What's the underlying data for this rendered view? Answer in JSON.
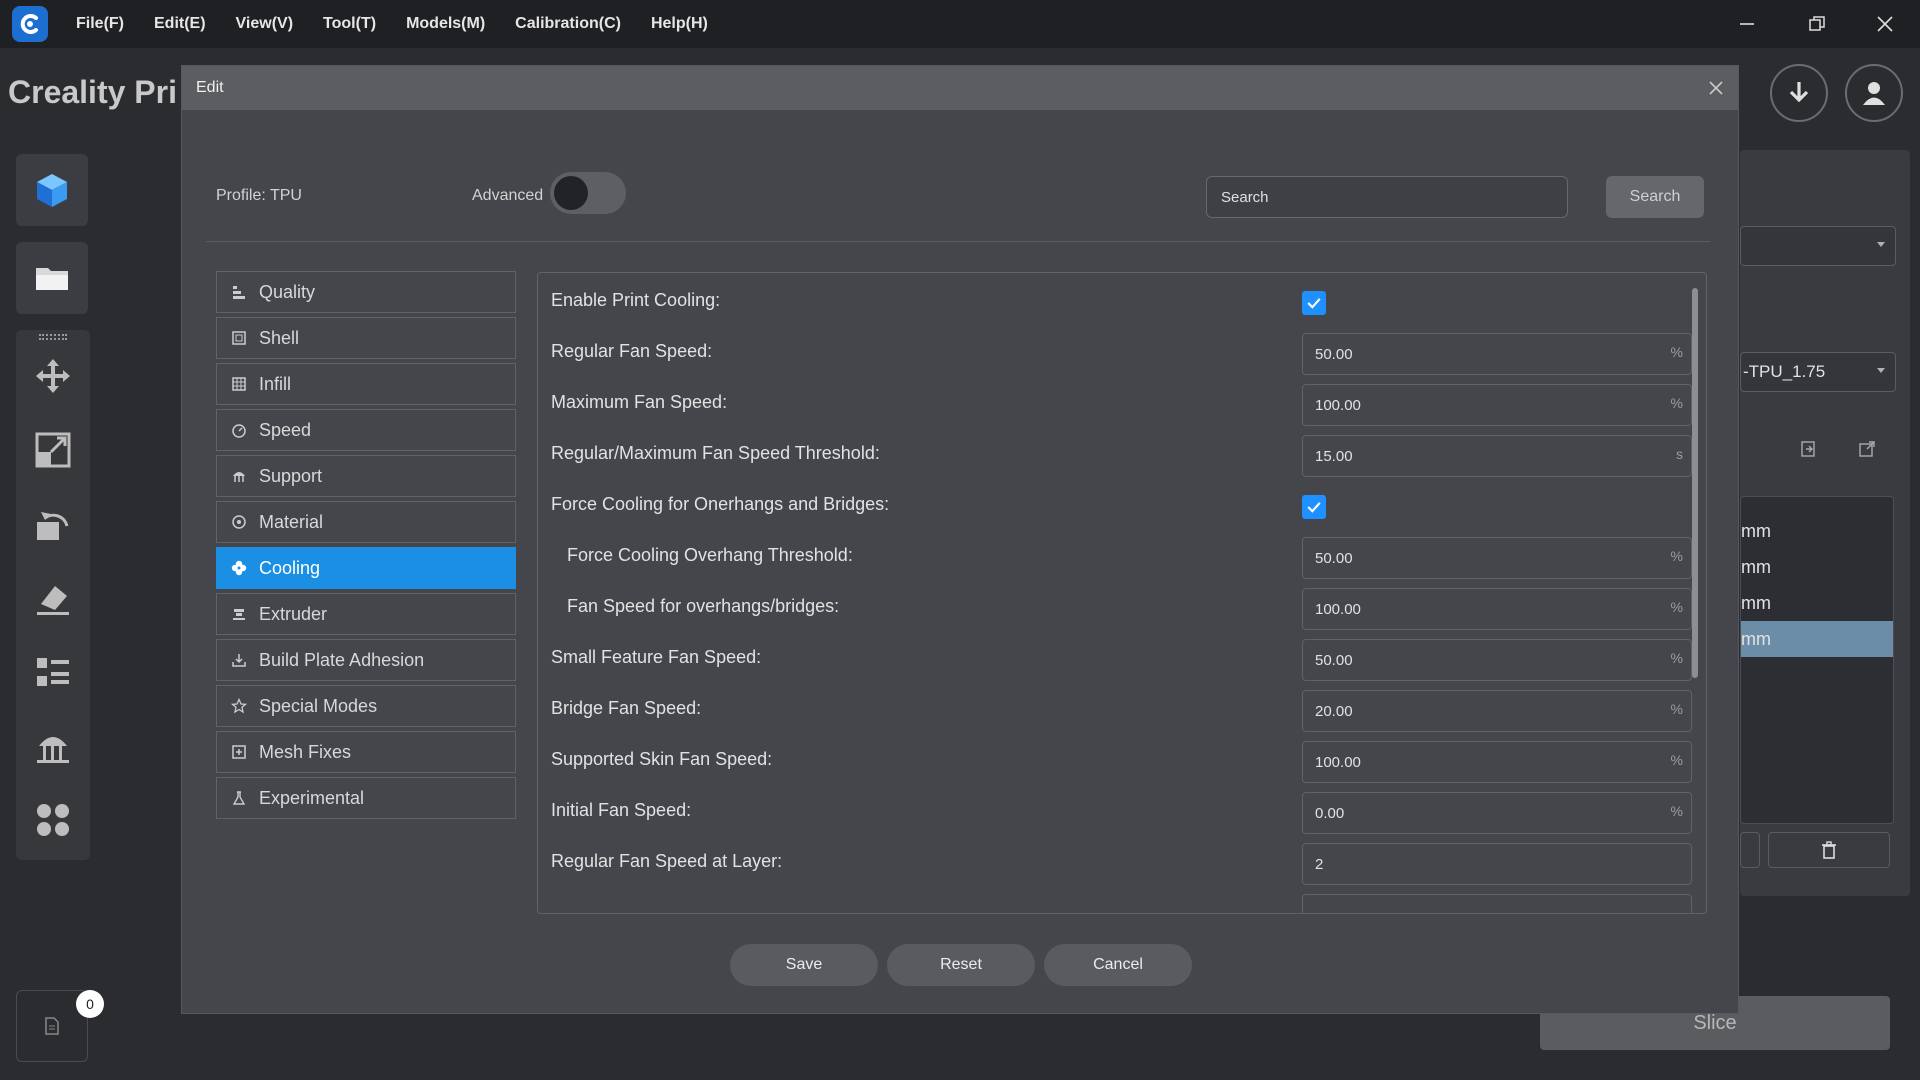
{
  "menubar": {
    "items": [
      "File(F)",
      "Edit(E)",
      "View(V)",
      "Tool(T)",
      "Models(M)",
      "Calibration(C)",
      "Help(H)"
    ]
  },
  "app": {
    "title_partial": "Creality Pri"
  },
  "right_panel": {
    "material_select": "-TPU_1.75",
    "list_items": [
      "mm",
      "mm",
      "mm",
      "mm"
    ],
    "slice_label": "Slice",
    "job_count": "0"
  },
  "dialog": {
    "title": "Edit",
    "profile_label": "Profile:  TPU",
    "advanced_label": "Advanced",
    "search_placeholder": "Search",
    "search_button": "Search",
    "categories": [
      {
        "label": "Quality",
        "icon": "quality-icon"
      },
      {
        "label": "Shell",
        "icon": "shell-icon"
      },
      {
        "label": "Infill",
        "icon": "infill-icon"
      },
      {
        "label": "Speed",
        "icon": "speed-icon"
      },
      {
        "label": "Support",
        "icon": "support-icon"
      },
      {
        "label": "Material",
        "icon": "material-icon"
      },
      {
        "label": "Cooling",
        "icon": "fan-icon"
      },
      {
        "label": "Extruder",
        "icon": "extruder-icon"
      },
      {
        "label": "Build Plate Adhesion",
        "icon": "adhesion-icon"
      },
      {
        "label": "Special Modes",
        "icon": "star-icon"
      },
      {
        "label": "Mesh Fixes",
        "icon": "mesh-fix-icon"
      },
      {
        "label": "Experimental",
        "icon": "flask-icon"
      }
    ],
    "settings": [
      {
        "label": "Enable Print Cooling:",
        "checked": true
      },
      {
        "label": "Regular Fan Speed:",
        "value": "50.00",
        "unit": "%"
      },
      {
        "label": "Maximum Fan Speed:",
        "value": "100.00",
        "unit": "%"
      },
      {
        "label": "Regular/Maximum Fan Speed Threshold:",
        "value": "15.00",
        "unit": "s"
      },
      {
        "label": "Force Cooling for Onerhangs and Bridges:",
        "checked": true
      },
      {
        "label": "Force Cooling Overhang Threshold:",
        "value": "50.00",
        "unit": "%"
      },
      {
        "label": "Fan Speed for overhangs/bridges:",
        "value": "100.00",
        "unit": "%"
      },
      {
        "label": "Small Feature Fan Speed:",
        "value": "50.00",
        "unit": "%"
      },
      {
        "label": "Bridge Fan Speed:",
        "value": "20.00",
        "unit": "%"
      },
      {
        "label": "Supported Skin Fan Speed:",
        "value": "100.00",
        "unit": "%"
      },
      {
        "label": "Initial Fan Speed:",
        "value": "0.00",
        "unit": "%"
      },
      {
        "label": "Regular Fan Speed at Layer:",
        "value": "2",
        "unit": ""
      }
    ],
    "buttons": {
      "save": "Save",
      "reset": "Reset",
      "cancel": "Cancel"
    }
  },
  "colors": {
    "accent": "#1a8fe3",
    "checkbox": "#1e90ff",
    "dialog_bg": "#45464b",
    "titlebar_bg": "#1f2023"
  }
}
